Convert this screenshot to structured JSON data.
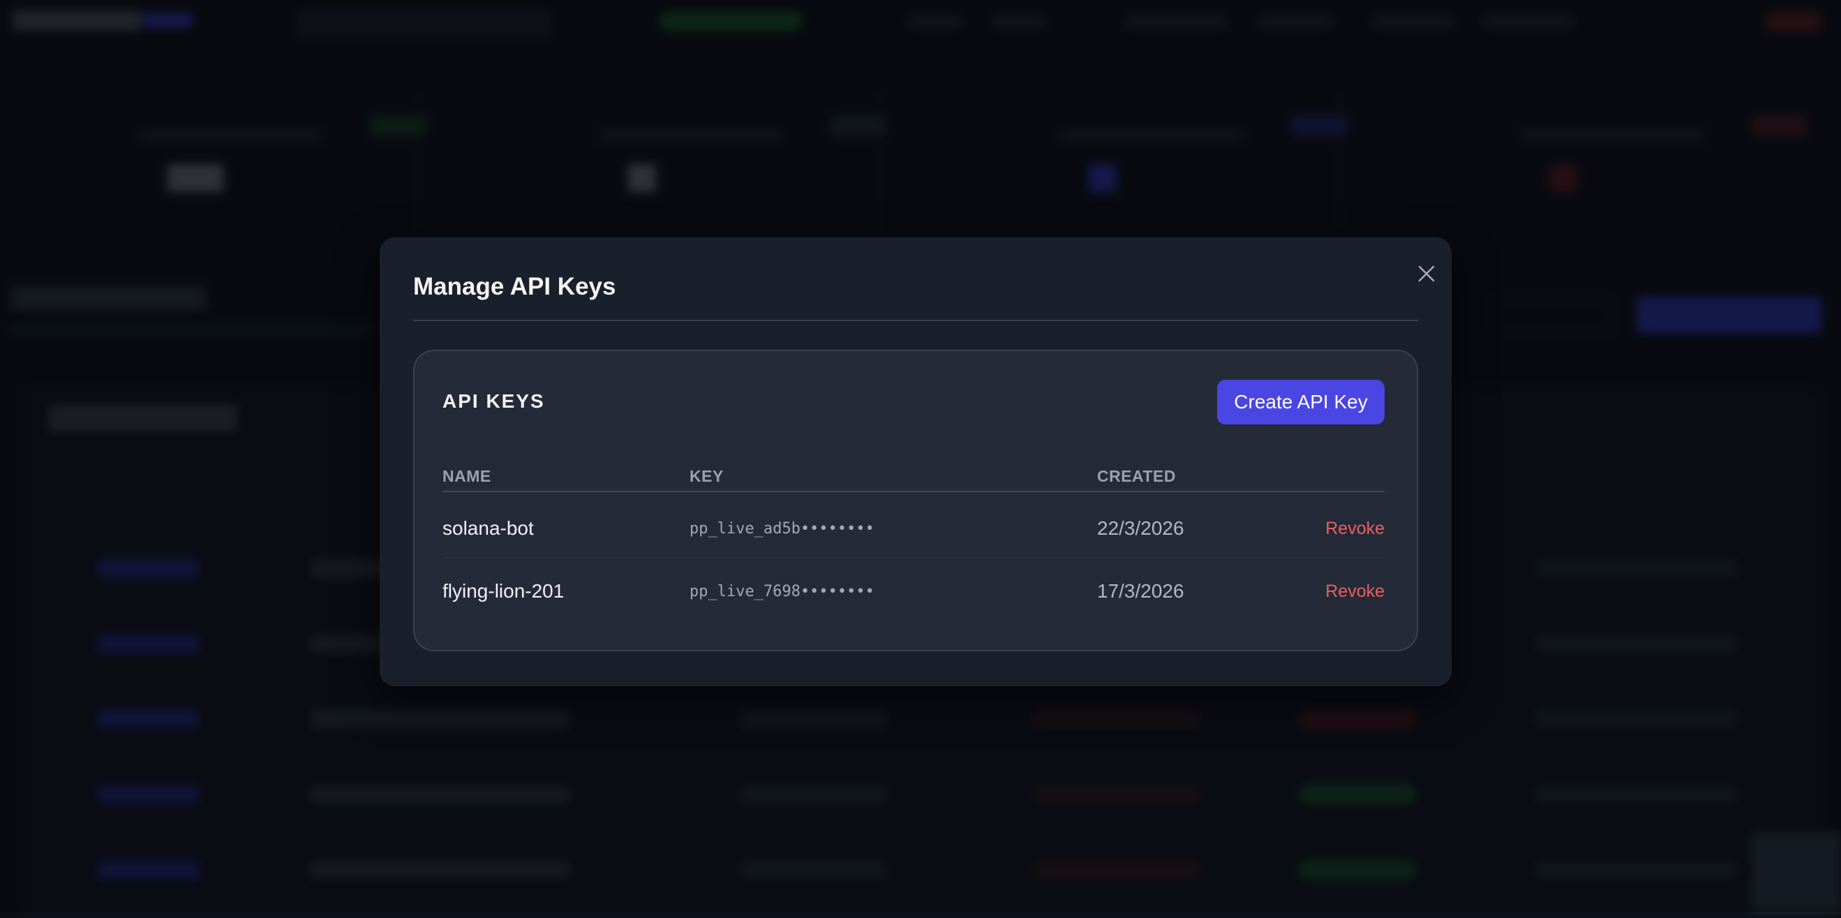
{
  "modal": {
    "title": "Manage API Keys",
    "close_icon": "close-icon"
  },
  "api_keys": {
    "heading": "API KEYS",
    "create_label": "Create API Key",
    "columns": {
      "name": "NAME",
      "key": "KEY",
      "created": "CREATED"
    },
    "rows": [
      {
        "name": "solana-bot",
        "key": "pp_live_ad5b••••••••",
        "created": "22/3/2026",
        "action": "Revoke"
      },
      {
        "name": "flying-lion-201",
        "key": "pp_live_7698••••••••",
        "created": "17/3/2026",
        "action": "Revoke"
      }
    ]
  },
  "colors": {
    "accent": "#4a46e4",
    "danger": "#ef5f5f",
    "modal_bg": "#1a202b",
    "card_bg": "#242a37"
  }
}
